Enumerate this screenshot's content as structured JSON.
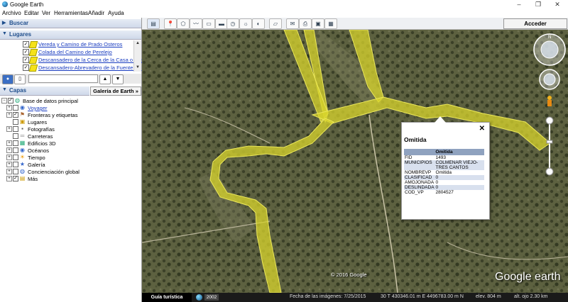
{
  "window": {
    "title": "Google Earth",
    "controls": [
      "–",
      "❐",
      "✕"
    ]
  },
  "menu": [
    {
      "label": "Archivo"
    },
    {
      "label": "Editar"
    },
    {
      "label": "Ver"
    },
    {
      "label": "Herramientas"
    },
    {
      "label": "Añadir"
    },
    {
      "label": "Ayuda"
    }
  ],
  "sidebar": {
    "search_header": "Buscar",
    "places_header": "Lugares",
    "places": [
      "Vereda y Camino de Prado Osteros",
      "Colada del Camino de Perelejo",
      "Descansadero de la Cerca de la Casa o Tiest",
      "Descansadero-Abrevadero de la Fuente del"
    ],
    "layers_header": "Capas",
    "gallery_button": "Galería de Earth »",
    "layers": [
      {
        "label": "Base de datos principal",
        "icon": "globe-icon",
        "checked": true
      },
      {
        "label": "Voyager",
        "icon": "voyager-icon",
        "checked": false,
        "link": true
      },
      {
        "label": "Fronteras y etiquetas",
        "icon": "borders-icon",
        "checked": true
      },
      {
        "label": "Lugares",
        "icon": "places-icon",
        "checked": false
      },
      {
        "label": "Fotografías",
        "icon": "photos-icon",
        "checked": false
      },
      {
        "label": "Carreteras",
        "icon": "roads-icon",
        "checked": false
      },
      {
        "label": "Edificios 3D",
        "icon": "buildings-icon",
        "checked": false
      },
      {
        "label": "Océanos",
        "icon": "ocean-icon",
        "checked": false
      },
      {
        "label": "Tiempo",
        "icon": "weather-icon",
        "checked": false
      },
      {
        "label": "Galería",
        "icon": "gallery-icon",
        "checked": false
      },
      {
        "label": "Concienciación global",
        "icon": "global-awareness-icon",
        "checked": false
      },
      {
        "label": "Más",
        "icon": "more-icon",
        "checked": true
      }
    ]
  },
  "toolbar": {
    "signin_label": "Acceder"
  },
  "popup": {
    "title": "Omitida",
    "table_header": "Omitida",
    "rows": [
      [
        "FID",
        "1493"
      ],
      [
        "MUNICIPIOS",
        "COLMENAR VIEJO-TRES CANTOS"
      ],
      [
        "NOMBREVP",
        "Omitida"
      ],
      [
        "CLASIFICAD",
        "0"
      ],
      [
        "AMOJONADA",
        "0"
      ],
      [
        "DESLINDADA",
        "0"
      ],
      [
        "COD_VP",
        "2804527"
      ]
    ]
  },
  "map": {
    "copyright": "© 2016 Google",
    "logo": "Google earth",
    "overlay_color": "#e0dc2e"
  },
  "status": {
    "tour_label": "Guía turística",
    "year": "2002",
    "imagery_date": "Fecha de las imágenes: 7/25/2015",
    "coords": "30 T 430346.01 m E 4496783.00 m N",
    "elevation": "elev.   804 m",
    "eye_alt": "alt. ojo   2.30 km"
  }
}
